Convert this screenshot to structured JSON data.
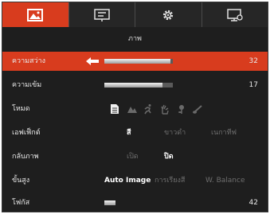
{
  "tabs": [
    {
      "name": "image",
      "icon": "image-icon",
      "active": true
    },
    {
      "name": "display",
      "icon": "presentation-icon",
      "active": false
    },
    {
      "name": "settings",
      "icon": "gear-icon",
      "active": false
    },
    {
      "name": "system",
      "icon": "monitor-settings-icon",
      "active": false
    }
  ],
  "section_title": "ภาพ",
  "rows": {
    "brightness": {
      "label": "ความสว่าง",
      "value": "32",
      "level": 0.32
    },
    "contrast": {
      "label": "ความเข้ม",
      "value": "17",
      "level": 0.17
    },
    "mode": {
      "label": "โหมด",
      "icons": [
        "document-icon",
        "mountain-icon",
        "running-person-icon",
        "hand-icon",
        "flower-icon",
        "brush-icon"
      ]
    },
    "effect": {
      "label": "เอฟเฟ็กต์",
      "options": [
        "สี",
        "ขาวดำ",
        "เนกาทีฟ"
      ],
      "selected": 0
    },
    "flip": {
      "label": "กลับภาพ",
      "options": [
        "เปิด",
        "ปิด"
      ],
      "selected": 1
    },
    "advanced": {
      "label": "ขั้นสูง",
      "options": [
        "Auto Image",
        "การเรียงสี",
        "W. Balance"
      ],
      "selected": 0
    },
    "focus": {
      "label": "โฟกัส",
      "value": "42",
      "level": 0.16
    }
  },
  "colors": {
    "accent": "#d83c1e",
    "background": "#1e1e1e"
  }
}
